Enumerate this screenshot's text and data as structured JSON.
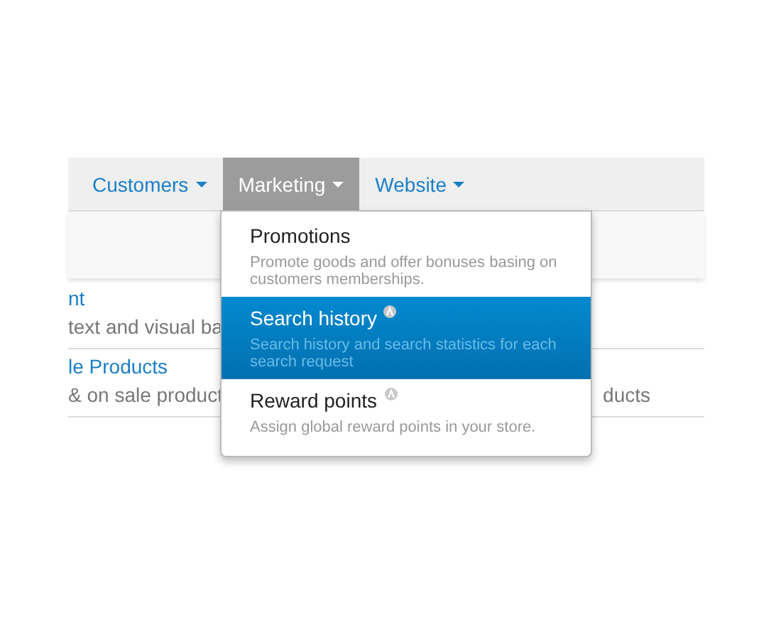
{
  "nav": [
    {
      "label": "Customers",
      "selected": false
    },
    {
      "label": "Marketing",
      "selected": true
    },
    {
      "label": "Website",
      "selected": false
    }
  ],
  "rows": [
    {
      "title": "nt",
      "description": "text and visual ba",
      "extra": ""
    },
    {
      "title": "le Products",
      "description": "& on sale product",
      "extra": "ducts"
    }
  ],
  "dropdown": [
    {
      "title": "Promotions",
      "description": "Promote goods and offer bonuses basing on customers memberships.",
      "selected": false,
      "badge": false
    },
    {
      "title": "Search history",
      "description": "Search history and search statistics for each search request",
      "selected": true,
      "badge": true
    },
    {
      "title": "Reward points",
      "description": "Assign global reward points in your store.",
      "selected": false,
      "badge": true
    }
  ]
}
